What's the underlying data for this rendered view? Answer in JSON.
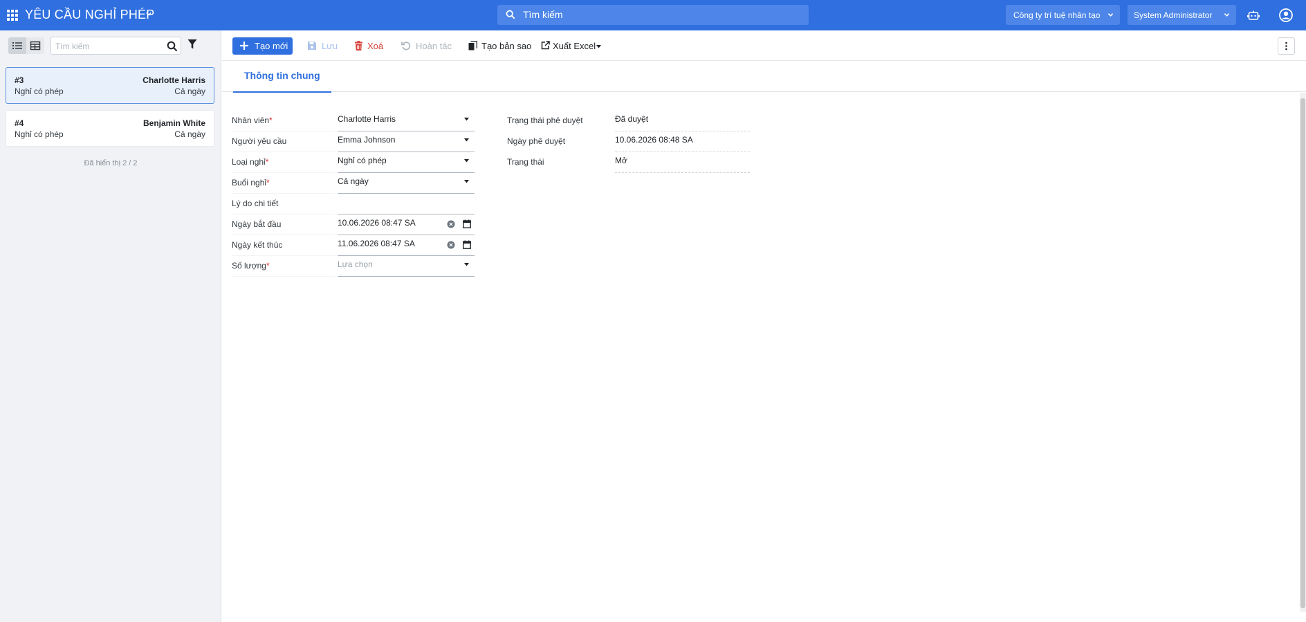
{
  "navbar": {
    "app_title": "YÊU CẦU NGHỈ PHÉP",
    "search_placeholder": "Tìm kiếm",
    "company": "Công ty trí tuệ nhân tạo",
    "user": "System Administrator"
  },
  "sidebar": {
    "search_placeholder": "Tìm kiếm",
    "records": [
      {
        "number": "#3",
        "employee": "Charlotte Harris",
        "leave_type": "Nghỉ có phép",
        "session": "Cả ngày",
        "selected": true
      },
      {
        "number": "#4",
        "employee": "Benjamin White",
        "leave_type": "Nghỉ có phép",
        "session": "Cả ngày",
        "selected": false
      }
    ],
    "shown_text": "Đã hiển thị 2 / 2"
  },
  "toolbar": {
    "new_label": "Tạo mới",
    "save_label": "Lưu",
    "delete_label": "Xoá",
    "undo_label": "Hoàn tác",
    "copy_label": "Tạo bản sao",
    "export_label": "Xuất Excel"
  },
  "tabs": [
    {
      "label": "Thông tin chung",
      "active": true
    }
  ],
  "form": {
    "left": [
      {
        "label": "Nhân viên",
        "required": "*",
        "value": "Charlotte Harris",
        "kind": "select"
      },
      {
        "label": "Người yêu cầu",
        "required": "",
        "value": "Emma Johnson",
        "kind": "select"
      },
      {
        "label": "Loại nghỉ",
        "required": "*",
        "value": "Nghỉ có phép",
        "kind": "select"
      },
      {
        "label": "Buổi nghỉ",
        "required": "*",
        "value": "Cả ngày",
        "kind": "select"
      },
      {
        "label": "Lý do chi tiết",
        "required": "",
        "value": "",
        "kind": "text"
      },
      {
        "label": "Ngày bắt đầu",
        "required": "",
        "value": "10.06.2026 08:47 SA",
        "kind": "date"
      },
      {
        "label": "Ngày kết thúc",
        "required": "",
        "value": "11.06.2026 08:47 SA",
        "kind": "date"
      },
      {
        "label": "Số lượng",
        "required": "*",
        "value": "Lựa chọn",
        "kind": "select-placeholder"
      }
    ],
    "right": [
      {
        "label": "Trạng thái phê duyệt",
        "value": "Đã duyệt"
      },
      {
        "label": "Ngày phê duyệt",
        "value": "10.06.2026 08:48 SA"
      },
      {
        "label": "Trạng thái",
        "value": "Mở"
      }
    ]
  },
  "colors": {
    "primary": "#2f6fdf",
    "danger": "#d9443b",
    "required": "#e03131"
  }
}
